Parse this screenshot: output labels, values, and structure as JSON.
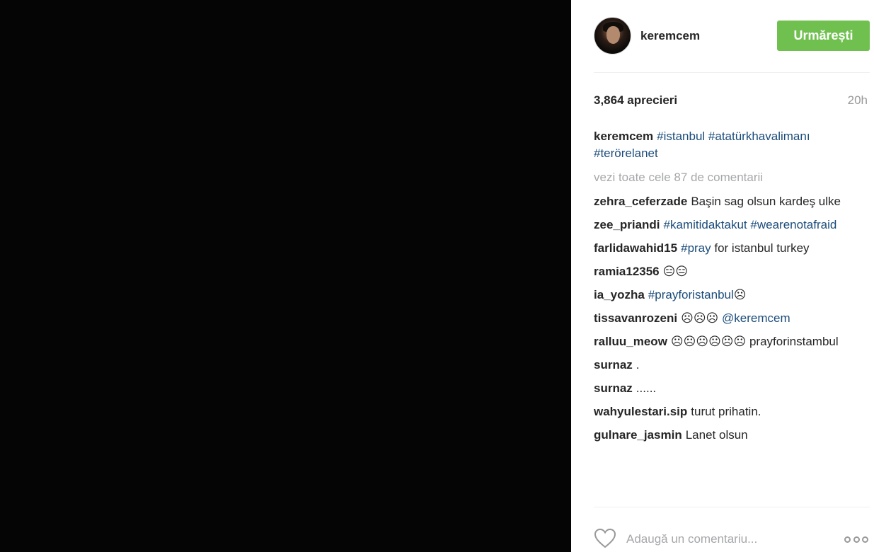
{
  "post": {
    "username": "keremcem",
    "follow_label": "Urmărești",
    "likes": "3,864 aprecieri",
    "time": "20h",
    "caption": {
      "user": "keremcem",
      "hashtags": [
        "#istanbul",
        "#atatürkhavalimanı",
        "#terörelanet"
      ]
    },
    "view_all": "vezi toate cele 87 de comentarii",
    "comments": [
      {
        "user": "zehra_ceferzade",
        "parts": [
          {
            "t": "txt",
            "v": "Başin sag olsun kardeş ulke"
          }
        ]
      },
      {
        "user": "zee_priandi",
        "parts": [
          {
            "t": "tag",
            "v": "#kamitidaktakut"
          },
          {
            "t": "txt",
            "v": " "
          },
          {
            "t": "tag",
            "v": "#wearenotafraid"
          }
        ]
      },
      {
        "user": "farlidawahid15",
        "parts": [
          {
            "t": "tag",
            "v": "#pray"
          },
          {
            "t": "txt",
            "v": " for istanbul turkey"
          }
        ]
      },
      {
        "user": "ramia12356",
        "parts": [
          {
            "t": "txt",
            "v": "😑😑"
          }
        ]
      },
      {
        "user": "ia_yozha",
        "parts": [
          {
            "t": "tag",
            "v": "#prayforistanbul"
          },
          {
            "t": "txt",
            "v": "☹"
          }
        ]
      },
      {
        "user": "tissavanrozeni",
        "parts": [
          {
            "t": "txt",
            "v": "☹☹☹ "
          },
          {
            "t": "tag",
            "v": "@keremcem"
          }
        ]
      },
      {
        "user": "ralluu_meow",
        "parts": [
          {
            "t": "txt",
            "v": "☹☹☹☹☹☹ prayforinstambul"
          }
        ]
      },
      {
        "user": "surnaz",
        "parts": [
          {
            "t": "txt",
            "v": "."
          }
        ]
      },
      {
        "user": "surnaz",
        "parts": [
          {
            "t": "txt",
            "v": "......"
          }
        ]
      },
      {
        "user": "wahyulestari.sip",
        "parts": [
          {
            "t": "txt",
            "v": "turut prihatin."
          }
        ]
      },
      {
        "user": "gulnare_jasmin",
        "parts": [
          {
            "t": "txt",
            "v": "Lanet olsun"
          }
        ]
      }
    ],
    "comment_placeholder": "Adaugă un comentariu..."
  },
  "colors": {
    "follow_button": "#70c050",
    "hashtag": "#1b4c7a",
    "photo_background": "#050505"
  },
  "icons": [
    "heart-icon",
    "more-options-icon"
  ]
}
